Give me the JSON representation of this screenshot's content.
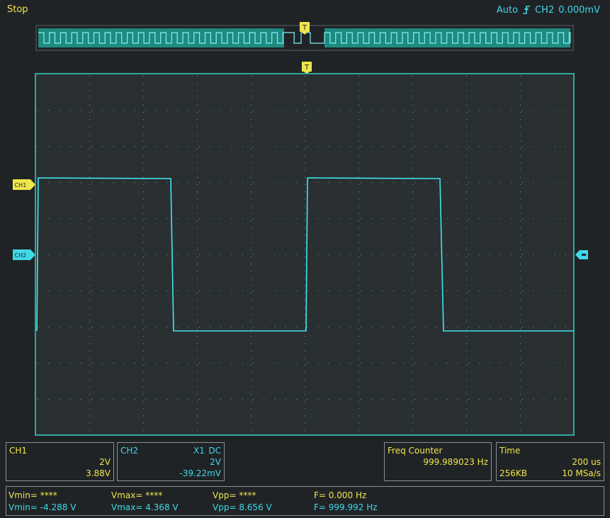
{
  "status": "Stop",
  "trigger": {
    "mode": "Auto",
    "channel": "CH2",
    "level": "0.000mV",
    "marker": "T"
  },
  "channel_markers": {
    "ch1": "CH1",
    "ch2": "CH2"
  },
  "ch1": {
    "label": "CH1",
    "scale": "2V",
    "offset": "3.88V"
  },
  "ch2": {
    "label": "CH2",
    "probe": "X1",
    "coupling": "DC",
    "scale": "2V",
    "offset": "-39.22mV"
  },
  "freq_counter": {
    "label": "Freq Counter",
    "value": "999.989023 Hz"
  },
  "time": {
    "label": "Time",
    "timebase": "200 us",
    "memory": "256KB",
    "sample_rate": "10 MSa/s"
  },
  "measurements": {
    "ch1": {
      "vmin": "Vmin= ****",
      "vmax": "Vmax= ****",
      "vpp": "Vpp= ****",
      "freq": "F= 0.000 Hz"
    },
    "ch2": {
      "vmin": "Vmin= -4.288 V",
      "vmax": "Vmax= 4.368 V",
      "vpp": "Vpp= 8.656 V",
      "freq": "F= 999.992 Hz"
    }
  },
  "colors": {
    "ch1": "#f0e64a",
    "ch2": "#3fd8e6",
    "grid_border": "#2fa89f",
    "background": "#202326",
    "screen": "#2a2f31"
  },
  "icons": {
    "trigger_edge": "rising-edge-icon"
  }
}
